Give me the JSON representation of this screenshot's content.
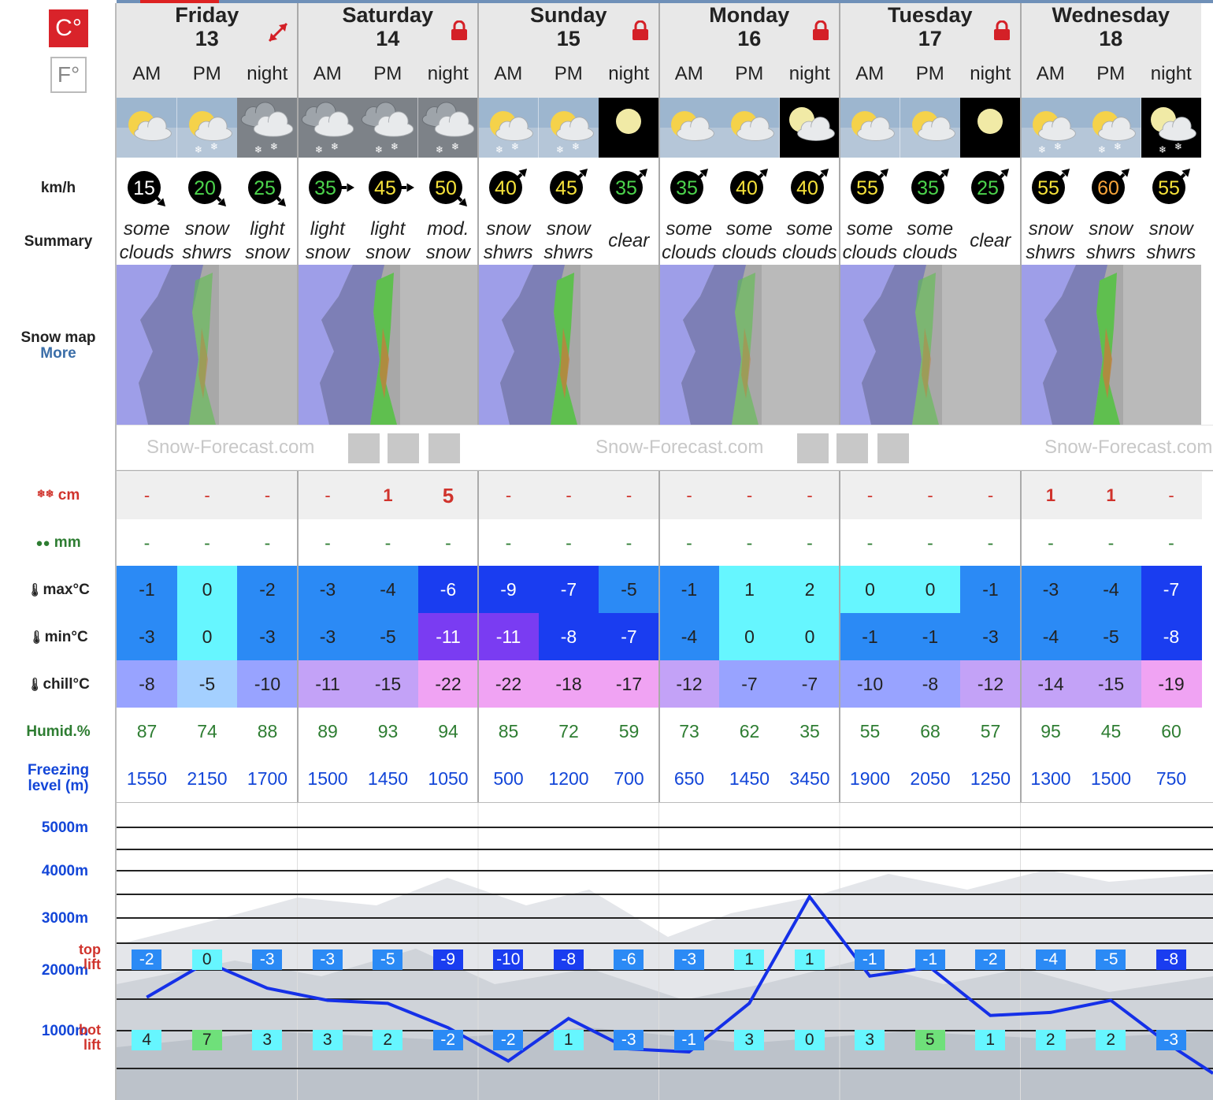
{
  "units": {
    "celsius": "C°",
    "fahrenheit": "F°"
  },
  "days": [
    {
      "name": "Friday",
      "date": "13",
      "icon": "expand-icon"
    },
    {
      "name": "Saturday",
      "date": "14",
      "icon": "lock-icon"
    },
    {
      "name": "Sunday",
      "date": "15",
      "icon": "lock-icon"
    },
    {
      "name": "Monday",
      "date": "16",
      "icon": "lock-icon"
    },
    {
      "name": "Tuesday",
      "date": "17",
      "icon": "lock-icon"
    },
    {
      "name": "Wednesday",
      "date": "18",
      "icon": ""
    }
  ],
  "periods": [
    "AM",
    "PM",
    "night",
    "AM",
    "PM",
    "night",
    "AM",
    "PM",
    "night",
    "AM",
    "PM",
    "night",
    "AM",
    "PM",
    "night",
    "AM",
    "PM",
    "night"
  ],
  "weather_icons": [
    "sun-cloud",
    "sun-cloud-snow",
    "cloud-snow",
    "cloud-snow",
    "cloud-snow",
    "cloud-snow",
    "sun-cloud-snow",
    "sun-cloud-snow",
    "moon",
    "sun-cloud",
    "sun-cloud",
    "moon-cloud",
    "sun-cloud",
    "sun-cloud",
    "moon",
    "sun-cloud-snow",
    "sun-cloud-snow",
    "moon-cloud-snow"
  ],
  "labels": {
    "wind": "km/h",
    "summary": "Summary",
    "snowmap": "Snow map",
    "more": "More",
    "snow": "cm",
    "rain": "mm",
    "max": "max°C",
    "min": "min°C",
    "chill": "chill°C",
    "humid": "Humid.%",
    "freezing1": "Freezing",
    "freezing2": "level (m)",
    "top1": "top",
    "lift": "lift",
    "bot1": "bot",
    "alt5000": "5000m",
    "alt4000": "4000m",
    "alt3000": "3000m",
    "alt2000": "2000m",
    "alt1000": "1000m"
  },
  "logo": "Snow-Forecast.com",
  "wind": [
    {
      "v": "15",
      "c": "#ffffff",
      "dir": 135
    },
    {
      "v": "20",
      "c": "#4cd44c",
      "dir": 135
    },
    {
      "v": "25",
      "c": "#4cd44c",
      "dir": 135
    },
    {
      "v": "35",
      "c": "#4cd44c",
      "dir": 90
    },
    {
      "v": "45",
      "c": "#f6e23a",
      "dir": 90
    },
    {
      "v": "50",
      "c": "#f6e23a",
      "dir": 135
    },
    {
      "v": "40",
      "c": "#f6e23a",
      "dir": 45
    },
    {
      "v": "45",
      "c": "#f6e23a",
      "dir": 45
    },
    {
      "v": "35",
      "c": "#4cd44c",
      "dir": 45
    },
    {
      "v": "35",
      "c": "#4cd44c",
      "dir": 45
    },
    {
      "v": "40",
      "c": "#f6e23a",
      "dir": 45
    },
    {
      "v": "40",
      "c": "#f6e23a",
      "dir": 45
    },
    {
      "v": "55",
      "c": "#f6e23a",
      "dir": 45
    },
    {
      "v": "35",
      "c": "#4cd44c",
      "dir": 45
    },
    {
      "v": "25",
      "c": "#4cd44c",
      "dir": 45
    },
    {
      "v": "55",
      "c": "#f6e23a",
      "dir": 45
    },
    {
      "v": "60",
      "c": "#f7a53a",
      "dir": 45
    },
    {
      "v": "55",
      "c": "#f6e23a",
      "dir": 45
    }
  ],
  "summary": [
    [
      "some",
      "clouds"
    ],
    [
      "snow",
      "shwrs"
    ],
    [
      "light",
      "snow"
    ],
    [
      "light",
      "snow"
    ],
    [
      "light",
      "snow"
    ],
    [
      "mod.",
      "snow"
    ],
    [
      "snow",
      "shwrs"
    ],
    [
      "snow",
      "shwrs"
    ],
    [
      "clear",
      ""
    ],
    [
      "some",
      "clouds"
    ],
    [
      "some",
      "clouds"
    ],
    [
      "some",
      "clouds"
    ],
    [
      "some",
      "clouds"
    ],
    [
      "some",
      "clouds"
    ],
    [
      "clear",
      ""
    ],
    [
      "snow",
      "shwrs"
    ],
    [
      "snow",
      "shwrs"
    ],
    [
      "snow",
      "shwrs"
    ]
  ],
  "snow_cm": [
    "-",
    "-",
    "-",
    "-",
    "1",
    "5",
    "-",
    "-",
    "-",
    "-",
    "-",
    "-",
    "-",
    "-",
    "-",
    "1",
    "1",
    "-"
  ],
  "rain_mm": [
    "-",
    "-",
    "-",
    "-",
    "-",
    "-",
    "-",
    "-",
    "-",
    "-",
    "-",
    "-",
    "-",
    "-",
    "-",
    "-",
    "-",
    "-"
  ],
  "max_c": [
    "-1",
    "0",
    "-2",
    "-3",
    "-4",
    "-6",
    "-9",
    "-7",
    "-5",
    "-1",
    "1",
    "2",
    "0",
    "0",
    "-1",
    "-3",
    "-4",
    "-7"
  ],
  "min_c": [
    "-3",
    "0",
    "-3",
    "-3",
    "-5",
    "-11",
    "-11",
    "-8",
    "-7",
    "-4",
    "0",
    "0",
    "-1",
    "-1",
    "-3",
    "-4",
    "-5",
    "-8"
  ],
  "chill_c": [
    "-8",
    "-5",
    "-10",
    "-11",
    "-15",
    "-22",
    "-22",
    "-18",
    "-17",
    "-12",
    "-7",
    "-7",
    "-10",
    "-8",
    "-12",
    "-14",
    "-15",
    "-19"
  ],
  "humidity": [
    "87",
    "74",
    "88",
    "89",
    "93",
    "94",
    "85",
    "72",
    "59",
    "73",
    "62",
    "35",
    "55",
    "68",
    "57",
    "95",
    "45",
    "60"
  ],
  "freezing_m": [
    "1550",
    "2150",
    "1700",
    "1500",
    "1450",
    "1050",
    "500",
    "1200",
    "700",
    "650",
    "1450",
    "3450",
    "1900",
    "2050",
    "1250",
    "1300",
    "1500",
    "750"
  ],
  "top_lift": [
    "-2",
    "0",
    "-3",
    "-3",
    "-5",
    "-9",
    "-10",
    "-8",
    "-6",
    "-3",
    "1",
    "1",
    "-1",
    "-1",
    "-2",
    "-4",
    "-5",
    "-8"
  ],
  "bot_lift": [
    "4",
    "7",
    "3",
    "3",
    "2",
    "-2",
    "-2",
    "1",
    "-3",
    "-1",
    "3",
    "0",
    "3",
    "5",
    "1",
    "2",
    "2",
    "-3"
  ]
}
